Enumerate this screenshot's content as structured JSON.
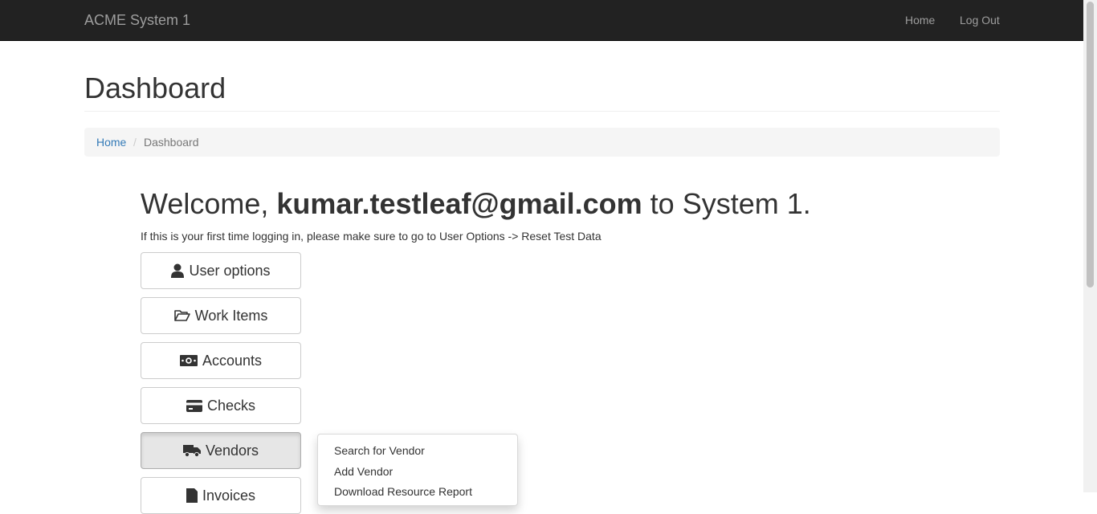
{
  "navbar": {
    "brand": "ACME System 1",
    "links": [
      "Home",
      "Log Out"
    ]
  },
  "page": {
    "title": "Dashboard"
  },
  "breadcrumb": {
    "home": "Home",
    "separator": "/",
    "current": "Dashboard"
  },
  "welcome": {
    "prefix": "Welcome, ",
    "user": "kumar.testleaf@gmail.com",
    "suffix": " to System 1.",
    "hint": "If this is your first time logging in, please make sure to go to User Options -> Reset Test Data"
  },
  "buttons": [
    {
      "label": "User options",
      "icon": "user-icon"
    },
    {
      "label": "Work Items",
      "icon": "folder-open-icon"
    },
    {
      "label": "Accounts",
      "icon": "money-icon"
    },
    {
      "label": "Checks",
      "icon": "credit-card-icon"
    },
    {
      "label": "Vendors",
      "icon": "truck-icon",
      "active": true
    },
    {
      "label": "Invoices",
      "icon": "invoice-icon"
    }
  ],
  "vendors_menu": {
    "items": [
      "Search for Vendor",
      "Add Vendor",
      "Download Resource Report"
    ]
  }
}
